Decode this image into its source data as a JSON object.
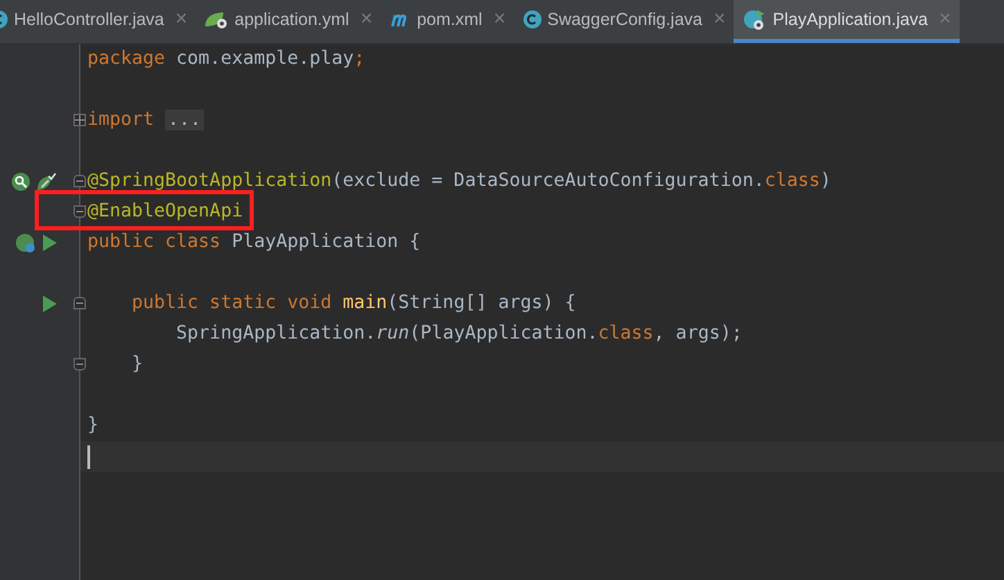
{
  "tabs": [
    {
      "label": "HelloController.java",
      "kind": "class",
      "selected": false
    },
    {
      "label": "application.yml",
      "kind": "yaml",
      "selected": false
    },
    {
      "label": "pom.xml",
      "kind": "maven",
      "selected": false
    },
    {
      "label": "SwaggerConfig.java",
      "kind": "class",
      "selected": false
    },
    {
      "label": "PlayApplication.java",
      "kind": "app",
      "selected": true
    }
  ],
  "close_glyph": "×",
  "lines": [
    {
      "kind": "code",
      "tokens": [
        {
          "kind": "keyword",
          "text": "package "
        },
        {
          "kind": "plain",
          "text": "com.example.play"
        },
        {
          "kind": "keyword",
          "text": ";"
        }
      ]
    },
    {
      "kind": "blank"
    },
    {
      "kind": "code",
      "fold": {
        "kind": "collapsed"
      },
      "tokens": [
        {
          "kind": "keyword",
          "text": "import "
        },
        {
          "kind": "folded",
          "text": "..."
        }
      ]
    },
    {
      "kind": "blank"
    },
    {
      "kind": "code",
      "fold": {
        "kind": "start"
      },
      "gutter": [
        {
          "kind": "bean-search"
        },
        {
          "kind": "leaf-check"
        }
      ],
      "tokens": [
        {
          "kind": "annotation",
          "text": "@SpringBootApplication"
        },
        {
          "kind": "plain",
          "text": "(exclude = DataSourceAutoConfiguration."
        },
        {
          "kind": "keyword",
          "text": "class"
        },
        {
          "kind": "plain",
          "text": ")"
        }
      ]
    },
    {
      "kind": "code",
      "fold": {
        "kind": "end"
      },
      "highlighted": true,
      "tokens": [
        {
          "kind": "annotation",
          "text": "@EnableOpenApi"
        }
      ]
    },
    {
      "kind": "code",
      "gutter": [
        {
          "kind": "bean"
        },
        {
          "kind": "run"
        }
      ],
      "tokens": [
        {
          "kind": "keyword",
          "text": "public class "
        },
        {
          "kind": "plain",
          "text": "PlayApplication {"
        }
      ]
    },
    {
      "kind": "blank"
    },
    {
      "kind": "code",
      "fold": {
        "kind": "start"
      },
      "gutter": [
        {
          "kind": "run"
        }
      ],
      "tokens": [
        {
          "kind": "keyword",
          "text": "    public static void "
        },
        {
          "kind": "method",
          "text": "main"
        },
        {
          "kind": "plain",
          "text": "(String[] args) {"
        }
      ]
    },
    {
      "kind": "code",
      "tokens": [
        {
          "kind": "plain",
          "text": "        SpringApplication."
        },
        {
          "kind": "italic",
          "text": "run"
        },
        {
          "kind": "plain",
          "text": "(PlayApplication."
        },
        {
          "kind": "keyword",
          "text": "class"
        },
        {
          "kind": "plain",
          "text": ", args);"
        }
      ]
    },
    {
      "kind": "code",
      "fold": {
        "kind": "end"
      },
      "tokens": [
        {
          "kind": "plain",
          "text": "    }"
        }
      ]
    },
    {
      "kind": "blank"
    },
    {
      "kind": "code",
      "tokens": [
        {
          "kind": "plain",
          "text": "}"
        }
      ]
    },
    {
      "kind": "cursor",
      "current": true
    }
  ]
}
